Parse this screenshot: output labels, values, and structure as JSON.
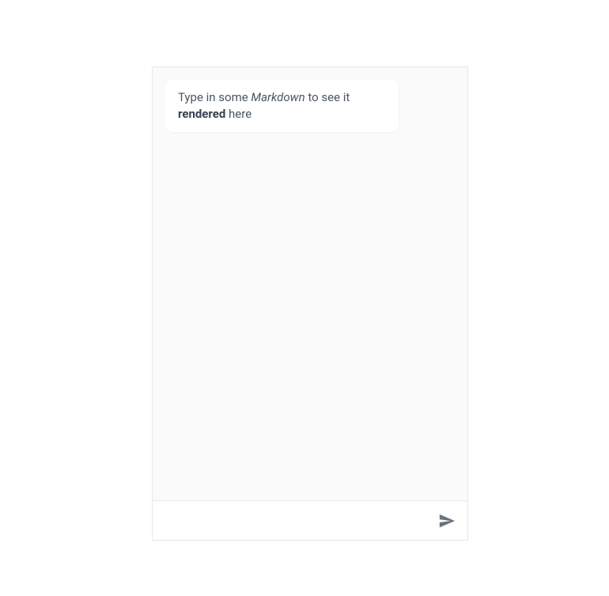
{
  "messages": [
    {
      "segments": [
        {
          "text": "Type in some ",
          "style": "normal"
        },
        {
          "text": "Markdown",
          "style": "italic"
        },
        {
          "text": " to see it ",
          "style": "normal"
        },
        {
          "text": "rendered",
          "style": "bold"
        },
        {
          "text": " here",
          "style": "normal"
        }
      ]
    }
  ],
  "input": {
    "value": "",
    "placeholder": ""
  },
  "icons": {
    "send": "send-icon"
  }
}
